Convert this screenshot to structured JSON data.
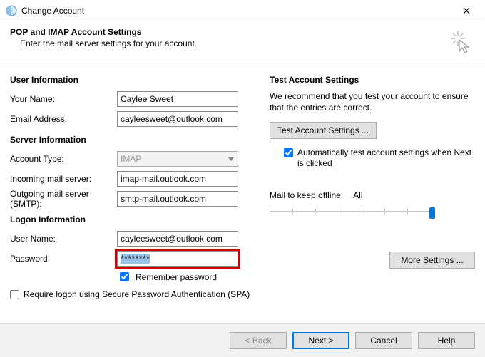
{
  "window": {
    "title": "Change Account",
    "close_tooltip": "Close"
  },
  "header": {
    "title": "POP and IMAP Account Settings",
    "subtitle": "Enter the mail server settings for your account."
  },
  "sections": {
    "user_info": "User Information",
    "server_info": "Server Information",
    "logon_info": "Logon Information",
    "test": "Test Account Settings"
  },
  "labels": {
    "your_name": "Your Name:",
    "email": "Email Address:",
    "account_type": "Account Type:",
    "incoming": "Incoming mail server:",
    "outgoing": "Outgoing mail server (SMTP):",
    "user_name": "User Name:",
    "password": "Password:",
    "remember_password": "Remember password",
    "require_spa": "Require logon using Secure Password Authentication (SPA)",
    "test_desc": "We recommend that you test your account to ensure that the entries are correct.",
    "auto_test": "Automatically test account settings when Next is clicked",
    "mail_offline": "Mail to keep offline:",
    "mail_offline_value": "All"
  },
  "values": {
    "your_name": "Caylee Sweet",
    "email": "cayleesweet@outlook.com",
    "account_type": "IMAP",
    "incoming": "imap-mail.outlook.com",
    "outgoing": "smtp-mail.outlook.com",
    "user_name": "cayleesweet@outlook.com",
    "password_mask": "********",
    "remember_password_checked": true,
    "require_spa_checked": false,
    "auto_test_checked": true
  },
  "buttons": {
    "test": "Test Account Settings ...",
    "more": "More Settings ...",
    "back": "< Back",
    "next": "Next >",
    "cancel": "Cancel",
    "help": "Help"
  }
}
